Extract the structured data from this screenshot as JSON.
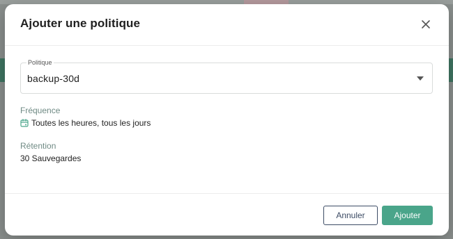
{
  "dialog": {
    "title": "Ajouter une politique",
    "close_icon": "close-icon"
  },
  "policy_select": {
    "label": "Politique",
    "value": "backup-30d",
    "icon": "chevron-down-icon"
  },
  "frequency": {
    "label": "Fréquence",
    "icon": "calendar-icon",
    "value": "Toutes les heures, tous les jours"
  },
  "retention": {
    "label": "Rétention",
    "value": "30 Sauvegardes"
  },
  "footer": {
    "cancel_label": "Annuler",
    "add_label": "Ajouter"
  },
  "colors": {
    "accent": "#4aa58a",
    "label_muted": "#6f8a84",
    "cancel_border": "#3c4b64"
  }
}
